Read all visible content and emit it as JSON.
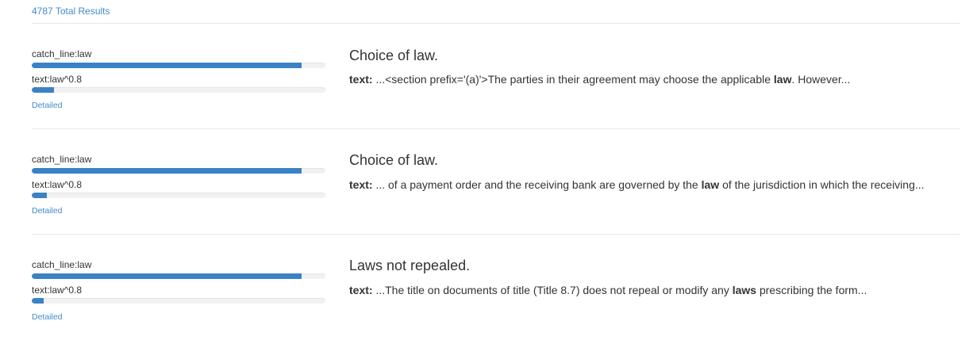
{
  "summary": {
    "total_results": "4787 Total Results"
  },
  "colors": {
    "bar_fill": "#3a82c4",
    "bar_track": "#f1f1f1",
    "link": "#428bca"
  },
  "results": [
    {
      "title": "Choice of law.",
      "scores": [
        {
          "label": "catch_line:law",
          "fraction": 0.92
        },
        {
          "label": "text:law^0.8",
          "fraction": 0.075
        }
      ],
      "detailed_label": "Detailed",
      "snippet": {
        "field_label": "text:",
        "before": " ...<section prefix='(a)'>The parties in their agreement may choose the applicable ",
        "highlight": "law",
        "after": ". However..."
      }
    },
    {
      "title": "Choice of law.",
      "scores": [
        {
          "label": "catch_line:law",
          "fraction": 0.92
        },
        {
          "label": "text:law^0.8",
          "fraction": 0.05
        }
      ],
      "detailed_label": "Detailed",
      "snippet": {
        "field_label": "text:",
        "before": " ... of a payment order and the receiving bank are governed by the ",
        "highlight": "law",
        "after": " of the jurisdiction in which the receiving..."
      }
    },
    {
      "title": "Laws not repealed.",
      "scores": [
        {
          "label": "catch_line:law",
          "fraction": 0.92
        },
        {
          "label": "text:law^0.8",
          "fraction": 0.04
        }
      ],
      "detailed_label": "Detailed",
      "snippet": {
        "field_label": "text:",
        "before": " ...The title on documents of title (Title 8.7) does not repeal or modify any ",
        "highlight": "laws",
        "after": " prescribing the form..."
      }
    }
  ]
}
